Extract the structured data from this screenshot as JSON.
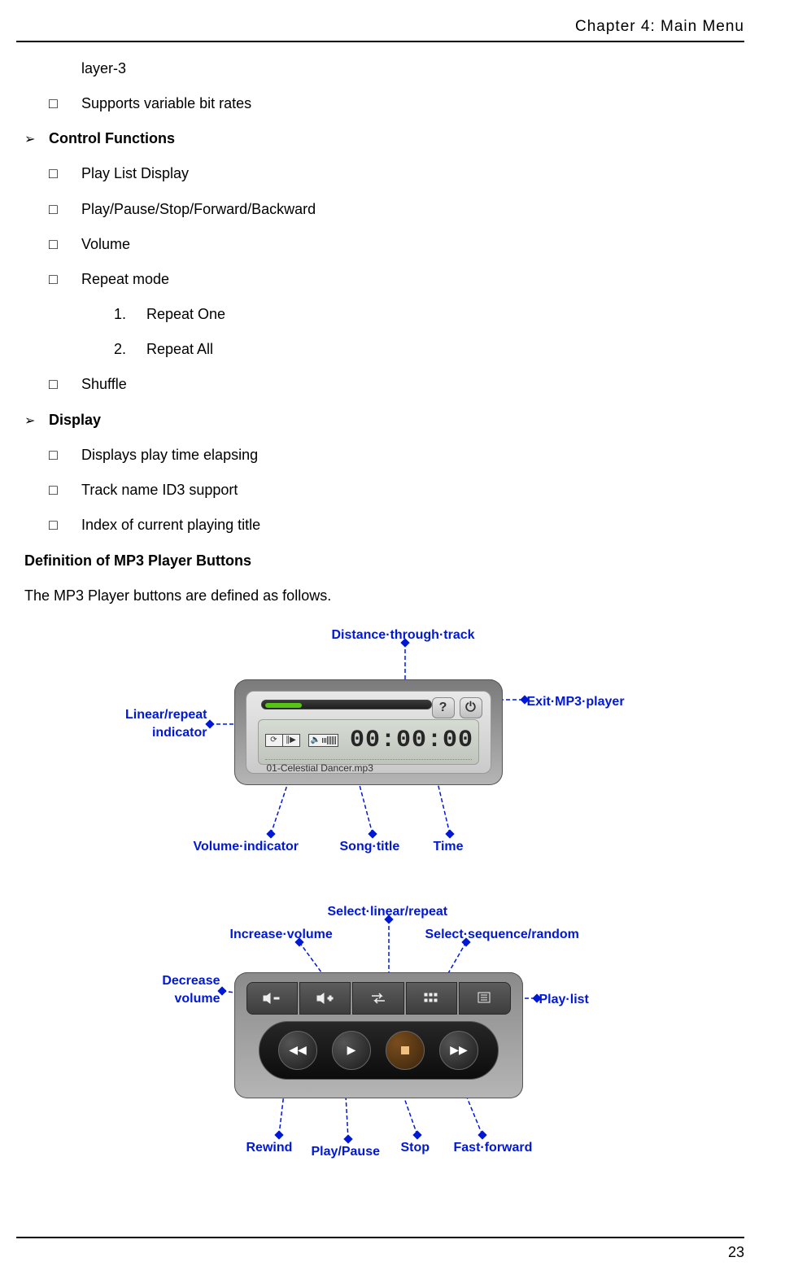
{
  "header": {
    "chapter_title": "Chapter 4: Main Menu"
  },
  "footer": {
    "page_number": "23"
  },
  "body": {
    "layer_line": "layer-3",
    "bitrate_line": "Supports variable bit rates",
    "control_functions_heading": "Control Functions",
    "control_items": {
      "playlist": "Play List Display",
      "playback": "Play/Pause/Stop/Forward/Backward",
      "volume": "Volume",
      "repeat": "Repeat mode",
      "repeat_one_num": "1.",
      "repeat_one": "Repeat One",
      "repeat_all_num": "2.",
      "repeat_all": "Repeat All",
      "shuffle": "Shuffle"
    },
    "display_heading": "Display",
    "display_items": {
      "elapsing": "Displays play time elapsing",
      "id3": "Track name ID3 support",
      "index": "Index of current playing title"
    },
    "definition_heading": "Definition of MP3 Player Buttons",
    "definition_intro": "The MP3 Player buttons are defined as follows."
  },
  "diagram1": {
    "player": {
      "time": "00:00:00",
      "help_icon": "?",
      "exit_icon": "⏻",
      "song_title": "01-Celestial Dancer.mp3",
      "mode_icon1": "⟳",
      "mode_icon2": "∥▶",
      "volume_icon": "🔈"
    },
    "labels": {
      "distance": "Distance·through·track",
      "exit": "Exit·MP3·player",
      "linear_l1": "Linear/repeat",
      "linear_l2": "indicator",
      "volume": "Volume·indicator",
      "song": "Song·title",
      "time": "Time"
    }
  },
  "diagram2": {
    "labels": {
      "select_linear": "Select·linear/repeat",
      "increase_vol": "Increase·volume",
      "select_seq": "Select·sequence/random",
      "decrease_l1": "Decrease",
      "decrease_l2": "volume",
      "playlist": "Play·list",
      "rewind": "Rewind",
      "playpause": "Play/Pause",
      "stop": "Stop",
      "ff": "Fast·forward"
    }
  }
}
